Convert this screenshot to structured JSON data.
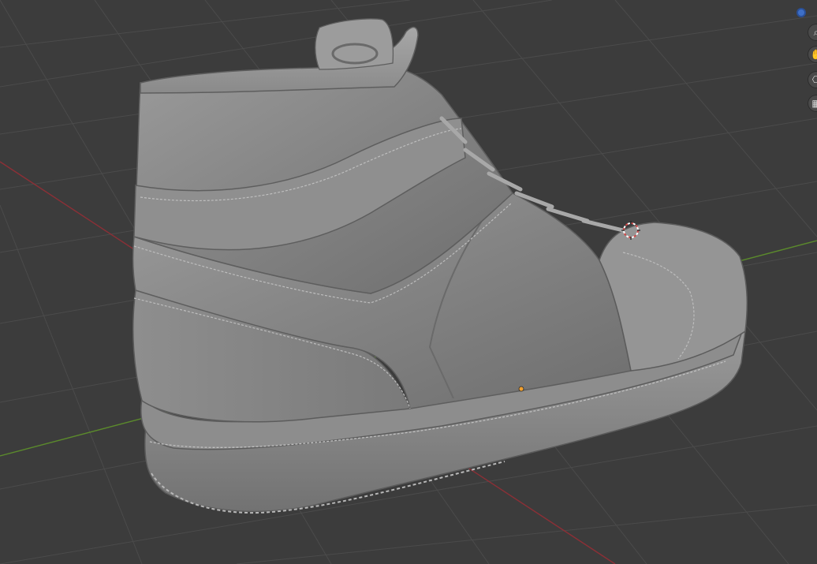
{
  "viewport": {
    "background": "#3c3c3c",
    "grid_color": "#4a4a4a",
    "x_axis_color": "#8c2f36",
    "y_axis_color": "#5b8a2c",
    "object": "shoe-model",
    "model_color": "#8a8a8a"
  },
  "navigation": {
    "axis_gizmo_color": "#3e6fc7",
    "buttons": [
      {
        "icon": "zoom-icon",
        "glyph": "⌕"
      },
      {
        "icon": "hand-icon",
        "glyph": "✋"
      },
      {
        "icon": "camera-icon",
        "glyph": "⎔"
      },
      {
        "icon": "ortho-grid-icon",
        "glyph": "▦"
      }
    ]
  },
  "markers": {
    "origin_color": "#f0a030",
    "cursor_colors": [
      "#d24848",
      "#ffffff"
    ]
  }
}
